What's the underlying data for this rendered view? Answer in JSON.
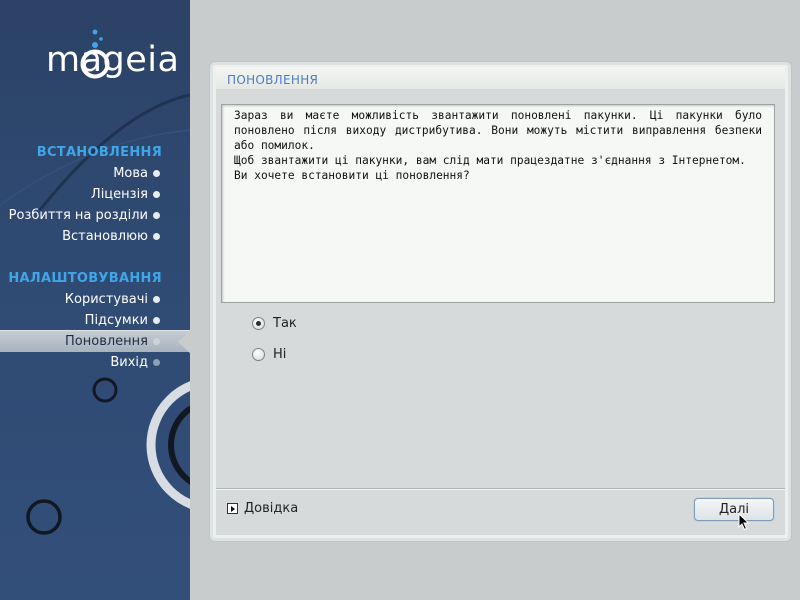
{
  "sidebar": {
    "logo_text": "mageia",
    "sections": [
      {
        "title": "ВСТАНОВЛЕННЯ",
        "items": [
          {
            "label": "Мова",
            "state": "done"
          },
          {
            "label": "Ліцензія",
            "state": "done"
          },
          {
            "label": "Розбиття на розділи",
            "state": "done"
          },
          {
            "label": "Встановлюю",
            "state": "done"
          }
        ]
      },
      {
        "title": "НАЛАШТОВУВАННЯ",
        "items": [
          {
            "label": "Користувачі",
            "state": "done"
          },
          {
            "label": "Підсумки",
            "state": "done"
          },
          {
            "label": "Поновлення",
            "state": "active"
          },
          {
            "label": "Вихід",
            "state": "pending"
          }
        ]
      }
    ]
  },
  "panel": {
    "title": "ПОНОВЛЕННЯ",
    "message_lines": [
      "Зараз ви маєте можливість звантажити поновлені пакунки. Ці пакунки було поновлено після виходу дистрибутива. Вони можуть містити виправлення безпеки або помилок.",
      "Щоб звантажити ці пакунки, вам слід мати працездатне з'єднання з Інтернетом.",
      "Ви хочете встановити ці поновлення?"
    ],
    "options": [
      {
        "label": "Так",
        "selected": true
      },
      {
        "label": "Ні",
        "selected": false
      }
    ],
    "help_label": "Довідка",
    "next_label": "Далі"
  },
  "colors": {
    "sidebar_bg": "#2f4a72",
    "section_title": "#3fa6e8",
    "panel_title": "#4a7ec0",
    "content_bg": "#d6dada"
  }
}
